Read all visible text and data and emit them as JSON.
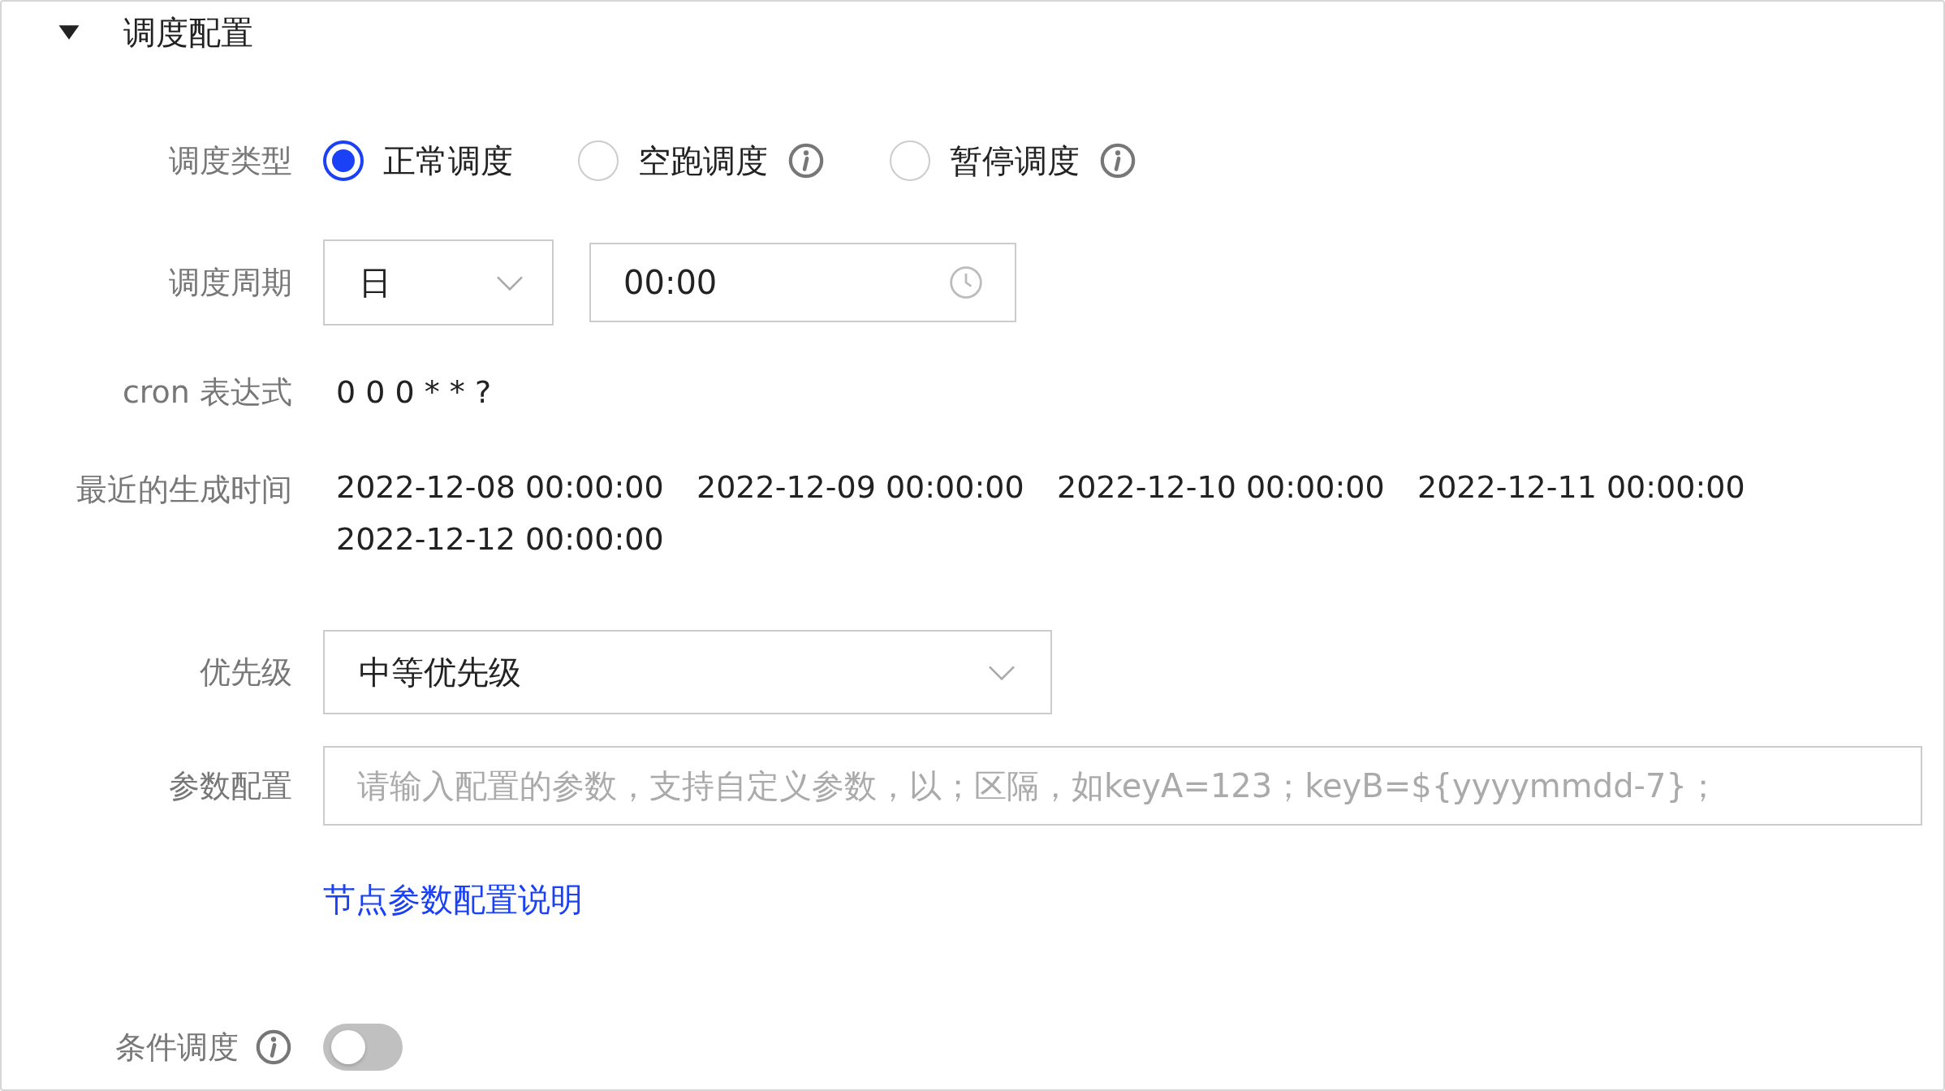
{
  "section": {
    "title": "调度配置",
    "expanded": true
  },
  "fields": [
    {
      "kind": "radio",
      "label": "调度类型",
      "options": [
        {
          "label": "正常调度",
          "selected": true,
          "info": false
        },
        {
          "label": "空跑调度",
          "selected": false,
          "info": true
        },
        {
          "label": "暂停调度",
          "selected": false,
          "info": true
        }
      ]
    },
    {
      "kind": "period",
      "label": "调度周期",
      "select": {
        "value": "日"
      },
      "time": {
        "value": "00:00"
      }
    },
    {
      "kind": "text",
      "label": "cron 表达式",
      "value": "0 0 0 * * ?"
    },
    {
      "kind": "times",
      "label": "最近的生成时间",
      "values": [
        "2022-12-08 00:00:00",
        "2022-12-09 00:00:00",
        "2022-12-10 00:00:00",
        "2022-12-11 00:00:00",
        "2022-12-12 00:00:00"
      ]
    },
    {
      "kind": "select",
      "label": "优先级",
      "value": "中等优先级"
    },
    {
      "kind": "input",
      "label": "参数配置",
      "placeholder": "请输入配置的参数，支持自定义参数，以；区隔，如keyA=123；keyB=${yyyymmdd-7}；"
    },
    {
      "kind": "link",
      "text": "节点参数配置说明"
    },
    {
      "kind": "toggle",
      "label": "条件调度",
      "info": true,
      "on": false
    }
  ]
}
